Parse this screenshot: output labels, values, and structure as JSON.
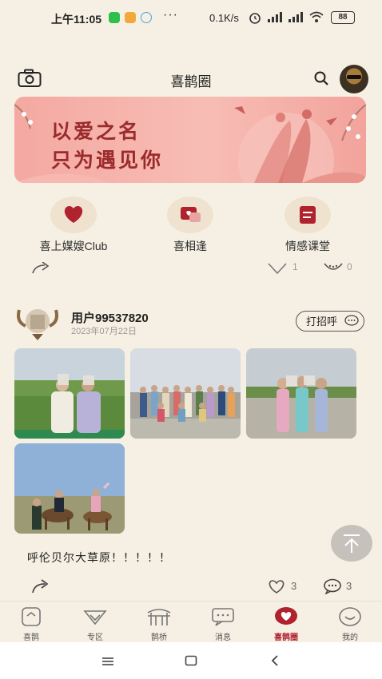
{
  "status_bar": {
    "time": "上午11:05",
    "dots": "···",
    "net_speed": "0.1K/s",
    "battery": "88"
  },
  "header": {
    "title": "喜鹊圈",
    "camera_icon": "camera-icon",
    "search_icon": "search-icon"
  },
  "banner": {
    "line1": "以爱之名",
    "line2": "只为遇见你"
  },
  "categories": [
    {
      "label": "喜上媒嫂Club",
      "icon": "heart-hand-icon"
    },
    {
      "label": "喜相逢",
      "icon": "heart-chat-icon"
    },
    {
      "label": "情感课堂",
      "icon": "notebook-icon"
    }
  ],
  "prev_post": {
    "likes": "1",
    "comments": "0"
  },
  "post": {
    "username": "用户99537820",
    "date": "2023年07月22日",
    "greet_button": "打招呼",
    "caption": "呼伦贝尔大草原！！！！！",
    "likes": "3",
    "comments": "3"
  },
  "tabbar": {
    "items": [
      {
        "label": "喜鹊",
        "icon": "home-icon"
      },
      {
        "label": "专区",
        "icon": "diamond-icon"
      },
      {
        "label": "鹊桥",
        "icon": "bridge-icon"
      },
      {
        "label": "消息",
        "icon": "message-icon"
      },
      {
        "label": "喜鹊圈",
        "icon": "heart-circle-icon"
      },
      {
        "label": "我的",
        "icon": "smile-icon"
      }
    ],
    "active": "喜鹊圈"
  },
  "colors": {
    "background": "#f6f0e4",
    "accent": "#b0222e",
    "banner": "#f4a9a2"
  }
}
